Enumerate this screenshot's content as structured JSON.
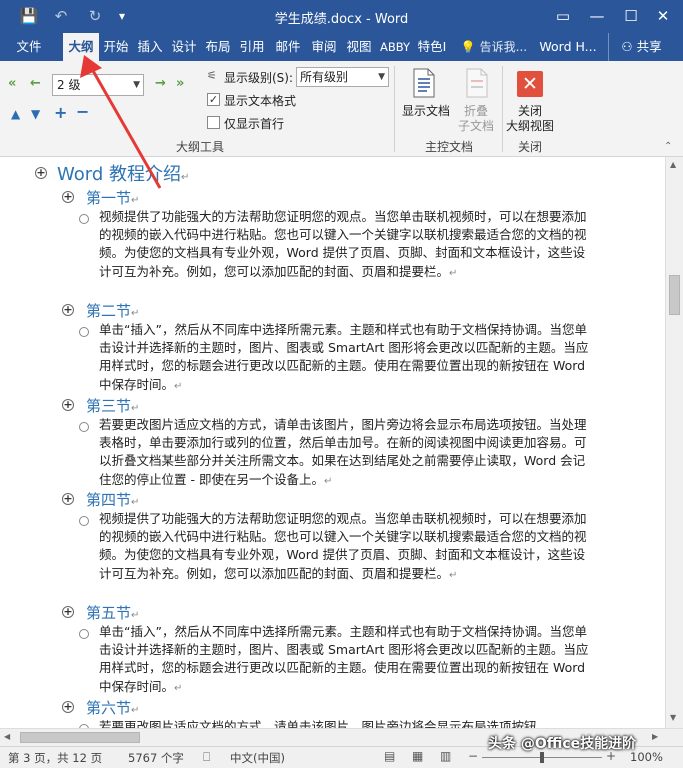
{
  "window": {
    "title": "学生成绩.docx - Word",
    "quick_access": {
      "save": "💾",
      "undo": "↶",
      "redo": "↻",
      "customize": "▾"
    },
    "controls": {
      "ribbon_options": "▭",
      "minimize": "—",
      "maximize": "☐",
      "close": "✕"
    }
  },
  "tabs": [
    {
      "label": "文件"
    },
    {
      "label": "大纲"
    },
    {
      "label": "开始"
    },
    {
      "label": "插入"
    },
    {
      "label": "设计"
    },
    {
      "label": "布局"
    },
    {
      "label": "引用"
    },
    {
      "label": "邮件"
    },
    {
      "label": "审阅"
    },
    {
      "label": "视图"
    },
    {
      "label": "ABBY"
    },
    {
      "label": "特色I"
    },
    {
      "label": "💡 告诉我..."
    },
    {
      "label": "Word H..."
    },
    {
      "label": "共享"
    }
  ],
  "ribbon": {
    "outline_tools": {
      "level_select": "2 级",
      "show_level_label": "显示级别(S):",
      "show_level_value": "所有级别",
      "show_text_format_label": "显示文本格式",
      "show_text_format_checked": true,
      "first_line_only_label": "仅显示首行",
      "first_line_only_checked": false,
      "group_label": "大纲工具"
    },
    "master_document": {
      "show_document_label": "显示文档",
      "collapse_label_line1": "折叠",
      "collapse_label_line2": "子文档",
      "group_label": "主控文档"
    },
    "close": {
      "close_label_line1": "关闭",
      "close_label_line2": "大纲视图",
      "group_label": "关闭"
    }
  },
  "document": {
    "heading1": "Word 教程介绍",
    "sections": [
      {
        "heading": "第一节",
        "body": "视频提供了功能强大的方法帮助您证明您的观点。当您单击联机视频时，可以在想要添加的视频的嵌入代码中进行粘贴。您也可以键入一个关键字以联机搜索最适合您的文档的视频。为使您的文档具有专业外观，Word 提供了页眉、页脚、封面和文本框设计，这些设计可互为补充。例如，您可以添加匹配的封面、页眉和提要栏。"
      },
      {
        "heading": "第二节",
        "body": "单击“插入”，然后从不同库中选择所需元素。主题和样式也有助于文档保持协调。当您单击设计并选择新的主题时，图片、图表或 SmartArt 图形将会更改以匹配新的主题。当应用样式时，您的标题会进行更改以匹配新的主题。使用在需要位置出现的新按钮在 Word 中保存时间。"
      },
      {
        "heading": "第三节",
        "body": "若要更改图片适应文档的方式，请单击该图片，图片旁边将会显示布局选项按钮。当处理表格时，单击要添加行或列的位置，然后单击加号。在新的阅读视图中阅读更加容易。可以折叠文档某些部分并关注所需文本。如果在达到结尾处之前需要停止读取，Word 会记住您的停止位置 - 即使在另一个设备上。"
      },
      {
        "heading": "第四节",
        "body": "视频提供了功能强大的方法帮助您证明您的观点。当您单击联机视频时，可以在想要添加的视频的嵌入代码中进行粘贴。您也可以键入一个关键字以联机搜索最适合您的文档的视频。为使您的文档具有专业外观，Word 提供了页眉、页脚、封面和文本框设计，这些设计可互为补充。例如，您可以添加匹配的封面、页眉和提要栏。"
      },
      {
        "heading": "第五节",
        "body": "单击“插入”，然后从不同库中选择所需元素。主题和样式也有助于文档保持协调。当您单击设计并选择新的主题时，图片、图表或 SmartArt 图形将会更改以匹配新的主题。当应用样式时，您的标题会进行更改以匹配新的主题。使用在需要位置出现的新按钮在 Word 中保存时间。"
      },
      {
        "heading": "第六节",
        "body": "若要更改图片适应文档的方式，请单击该图片，图片旁边将会显示布局选项按钮。"
      }
    ]
  },
  "status": {
    "page": "第 3 页，共 12 页",
    "words": "5767 个字",
    "language": "中文(中国)",
    "zoom": "100%"
  },
  "watermark": "头条 @Office技能进阶",
  "colors": {
    "accent": "#2b579a",
    "heading": "#2e74b5",
    "annotation": "#e53935"
  }
}
